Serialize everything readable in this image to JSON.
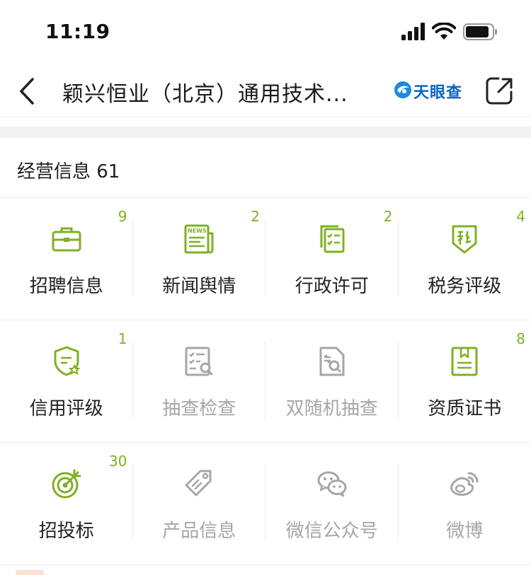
{
  "status": {
    "time": "11:19"
  },
  "nav": {
    "title": "颖兴恒业（北京）通用技术...",
    "brand_name": "天眼查"
  },
  "section": {
    "title": "经营信息 61"
  },
  "colors": {
    "accent_green": "#7fb024",
    "disabled_gray": "#a6a6a6",
    "brand_blue": "#0f63c5"
  },
  "grid": [
    [
      {
        "label": "招聘信息",
        "count": "9",
        "icon": "briefcase-icon",
        "enabled": true
      },
      {
        "label": "新闻舆情",
        "count": "2",
        "icon": "news-icon",
        "enabled": true
      },
      {
        "label": "行政许可",
        "count": "2",
        "icon": "license-icon",
        "enabled": true
      },
      {
        "label": "税务评级",
        "count": "4",
        "icon": "tax-shield-icon",
        "enabled": true
      }
    ],
    [
      {
        "label": "信用评级",
        "count": "1",
        "icon": "credit-shield-icon",
        "enabled": true
      },
      {
        "label": "抽查检查",
        "count": "",
        "icon": "inspection-icon",
        "enabled": false
      },
      {
        "label": "双随机抽查",
        "count": "",
        "icon": "random-inspection-icon",
        "enabled": false
      },
      {
        "label": "资质证书",
        "count": "8",
        "icon": "certificate-icon",
        "enabled": true
      }
    ],
    [
      {
        "label": "招投标",
        "count": "30",
        "icon": "target-icon",
        "enabled": true
      },
      {
        "label": "产品信息",
        "count": "",
        "icon": "tag-icon",
        "enabled": false
      },
      {
        "label": "微信公众号",
        "count": "",
        "icon": "wechat-icon",
        "enabled": false
      },
      {
        "label": "微博",
        "count": "",
        "icon": "weibo-icon",
        "enabled": false
      }
    ]
  ]
}
